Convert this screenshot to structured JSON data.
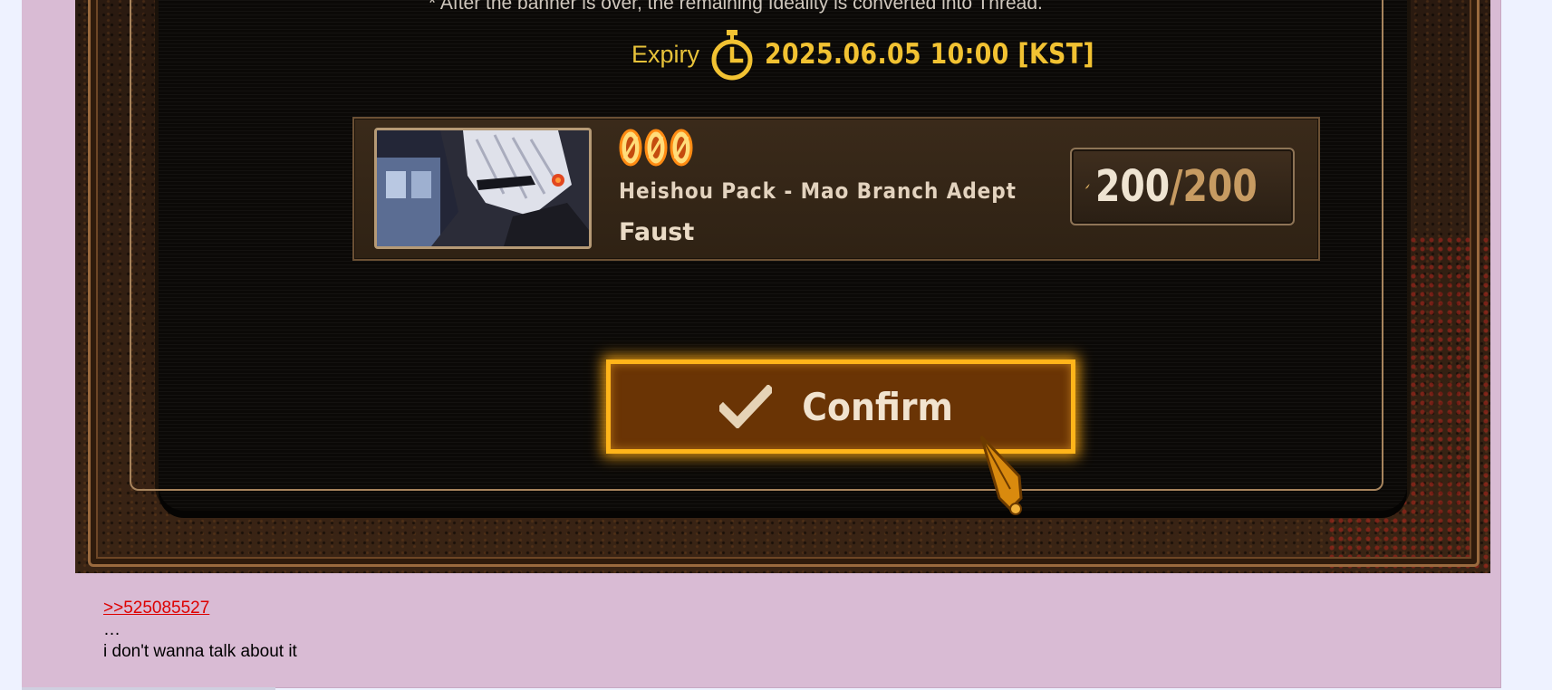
{
  "game": {
    "notice": "* After the banner is over, the remaining Ideality is converted into Thread.",
    "expiry_label": "Expiry",
    "expiry_date": "2025.06.05 10:00 [KST]",
    "reward": {
      "rarity_count": 3,
      "pack_title": "Heishou Pack - Mao Branch Adept",
      "character": "Faust",
      "thread_current": "200",
      "thread_separator": "/",
      "thread_max": "200"
    },
    "confirm_label": "Confirm"
  },
  "reply": {
    "quote": ">>525085527",
    "ellipsis": "…",
    "text": "i don't wanna talk about it"
  },
  "colors": {
    "post_bg": "#d9bbd4",
    "page_bg": "#eef2ff",
    "accent_gold": "#ffb51a",
    "quote_link": "#dd0000"
  }
}
